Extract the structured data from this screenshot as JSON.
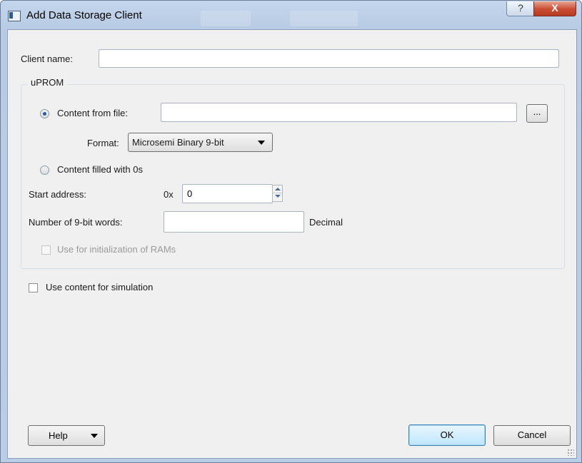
{
  "window": {
    "title": "Add Data Storage Client",
    "help_symbol": "?",
    "close_symbol": "X"
  },
  "client_name": {
    "label": "Client name:",
    "value": ""
  },
  "uprom": {
    "group_label": "uPROM",
    "content_from_file": {
      "label": "Content from file:",
      "selected": true,
      "file_path": "",
      "browse_label": "..."
    },
    "format": {
      "label": "Format:",
      "selected": "Microsemi Binary 9-bit"
    },
    "content_filled_zeros": {
      "label": "Content filled with 0s",
      "selected": false
    },
    "start_address": {
      "label": "Start address:",
      "prefix": "0x",
      "value": "0"
    },
    "word_count": {
      "label": "Number of 9-bit words:",
      "value": "",
      "unit": "Decimal"
    },
    "init_rams": {
      "label": "Use for initialization of RAMs",
      "checked": false,
      "enabled": false
    }
  },
  "simulation": {
    "label": "Use content for simulation",
    "checked": false
  },
  "footer": {
    "help_label": "Help",
    "ok_label": "OK",
    "cancel_label": "Cancel"
  }
}
